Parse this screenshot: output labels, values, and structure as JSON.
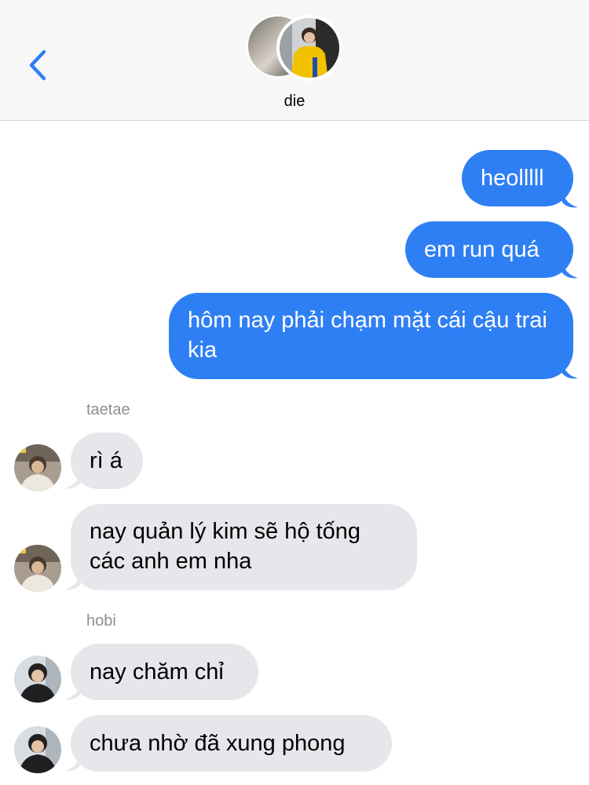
{
  "header": {
    "contact_name": "die",
    "back_icon": "chevron-left-icon",
    "accent": "#2f7ff4"
  },
  "messages": {
    "outgoing": [
      {
        "text": "heolllll"
      },
      {
        "text": "em run quá"
      },
      {
        "text": "hôm nay phải chạm mặt cái cậu trai kia"
      }
    ],
    "groups": [
      {
        "sender": "taetae",
        "messages": [
          {
            "text": "rì á"
          },
          {
            "text": "nay quản lý kim sẽ hộ tống các anh em nha"
          }
        ]
      },
      {
        "sender": "hobi",
        "messages": [
          {
            "text": "nay chăm chỉ"
          },
          {
            "text": "chưa nhờ đã xung phong"
          }
        ]
      }
    ]
  },
  "colors": {
    "outgoing_bubble": "#2f7ff4",
    "incoming_bubble": "#e6e6eb",
    "header_bg": "#f7f7f7"
  }
}
